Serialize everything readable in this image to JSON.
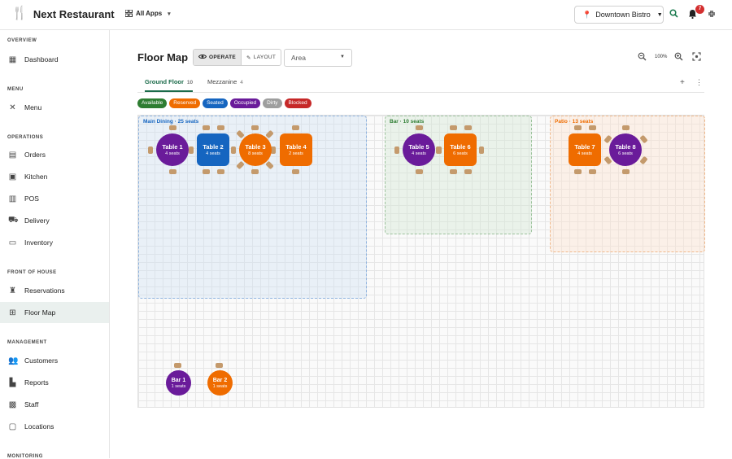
{
  "brand": {
    "name": "Next Restaurant",
    "logo_icon": "utensils-icon",
    "color": "#d32f2f"
  },
  "topbar": {
    "all_apps": "All Apps",
    "location": "Downtown Bistro",
    "notification_count": "7"
  },
  "sidebar": {
    "sections": {
      "overview": "OVERVIEW",
      "menu": "MENU",
      "operations": "OPERATIONS",
      "front": "FRONT OF HOUSE",
      "management": "MANAGEMENT",
      "monitoring": "MONITORING"
    },
    "items": {
      "dashboard": "Dashboard",
      "menu": "Menu",
      "orders": "Orders",
      "kitchen": "Kitchen",
      "pos": "POS",
      "delivery": "Delivery",
      "inventory": "Inventory",
      "reservations": "Reservations",
      "floor_map": "Floor Map",
      "customers": "Customers",
      "reports": "Reports",
      "staff": "Staff",
      "locations": "Locations"
    }
  },
  "main": {
    "title": "Floor Map",
    "mode_operate": "OPERATE",
    "mode_layout": "LAYOUT",
    "area_placeholder": "Area",
    "zoom": "100%",
    "tabs": [
      {
        "label": "Ground Floor",
        "count": "10"
      },
      {
        "label": "Mezzanine",
        "count": "4"
      }
    ],
    "legend": [
      {
        "label": "Available",
        "color": "#2e7d32"
      },
      {
        "label": "Reserved",
        "color": "#ef6c00"
      },
      {
        "label": "Seated",
        "color": "#1565c0"
      },
      {
        "label": "Occupied",
        "color": "#6a1b9a"
      },
      {
        "label": "Dirty",
        "color": "#9e9e9e"
      },
      {
        "label": "Blocked",
        "color": "#c62828"
      }
    ],
    "zones": {
      "main": "Main Dining · 25 seats",
      "bar": "Bar · 10 seats",
      "patio": "Patio · 13 seats"
    },
    "tables": {
      "t1": {
        "name": "Table 1",
        "seats": "4 seats"
      },
      "t2": {
        "name": "Table 2",
        "seats": "4 seats"
      },
      "t3": {
        "name": "Table 3",
        "seats": "8 seats"
      },
      "t4": {
        "name": "Table 4",
        "seats": "2 seats"
      },
      "t5": {
        "name": "Table 5",
        "seats": "4 seats"
      },
      "t6": {
        "name": "Table 6",
        "seats": "6 seats"
      },
      "t7": {
        "name": "Table 7",
        "seats": "4 seats"
      },
      "t8": {
        "name": "Table 8",
        "seats": "6 seats"
      },
      "b1": {
        "name": "Bar 1",
        "seats": "1 seats"
      },
      "b2": {
        "name": "Bar 2",
        "seats": "1 seats"
      }
    }
  }
}
